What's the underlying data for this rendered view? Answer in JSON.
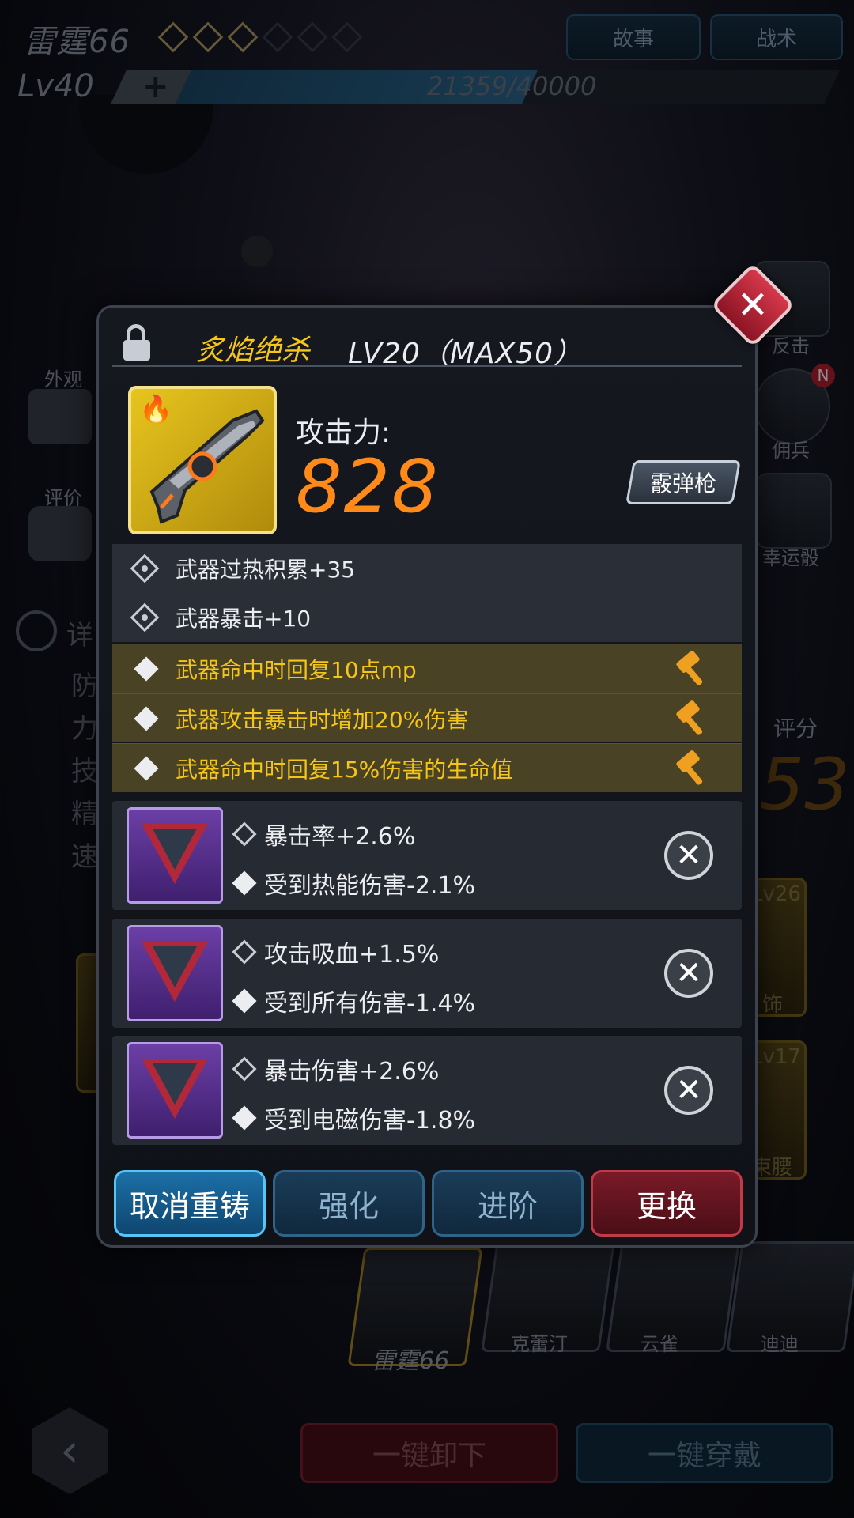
{
  "header": {
    "player_name": "雷霆66",
    "stars_filled": 3,
    "stars_total": 6,
    "story_label": "故事",
    "tactics_label": "战术",
    "level_label": "Lv40",
    "xp_plus": "+",
    "xp_text": "21359/40000",
    "xp_fraction": 0.534
  },
  "sidebar_left": {
    "appearance_label": "外观",
    "rating_label": "评价",
    "detail_label": "详",
    "rows": [
      "防",
      "力",
      "技",
      "精",
      "速"
    ]
  },
  "sidebar_right": {
    "counter_label": "反击",
    "mercenary_label": "佣兵",
    "badge": "N",
    "lucky_dice_label": "幸运骰",
    "score_label": "评分",
    "score_value": "53",
    "eq1_level": "Lv26",
    "eq1_label": "饰",
    "eq2_level": "Lv17",
    "eq2_label": "束腰"
  },
  "roster": {
    "active_name": "雷霆66",
    "others": [
      "克蕾汀",
      "云雀",
      "迪迪"
    ]
  },
  "bottom": {
    "unequip_all": "一键卸下",
    "equip_all": "一键穿戴",
    "back_glyph": "‹"
  },
  "modal": {
    "close_glyph": "✕",
    "weapon_name": "炙焰绝杀",
    "weapon_level": "LV20（MAX50）",
    "attack_label": "攻击力:",
    "attack_value": "828",
    "weapon_type": "霰弹枪",
    "base_attrs": [
      "武器过热积累+35",
      "武器暴击+10"
    ],
    "special_attrs": [
      "武器命中时回复10点mp",
      "武器攻击暴击时增加20%伤害",
      "武器命中时回复15%伤害的生命值"
    ],
    "chips": [
      {
        "stat1": "暴击率+2.6%",
        "stat2": "受到热能伤害-2.1%"
      },
      {
        "stat1": "攻击吸血+1.5%",
        "stat2": "受到所有伤害-1.4%"
      },
      {
        "stat1": "暴击伤害+2.6%",
        "stat2": "受到电磁伤害-1.8%"
      }
    ],
    "remove_glyph": "✕",
    "buttons": {
      "cancel_reforge": "取消重铸",
      "enhance": "强化",
      "advance": "进阶",
      "replace": "更换"
    }
  },
  "colors": {
    "gold_text": "#f5c518",
    "attack_orange": "#ff8a1a",
    "primary_blue": "#56c4f5",
    "danger_red": "#c03a48"
  }
}
